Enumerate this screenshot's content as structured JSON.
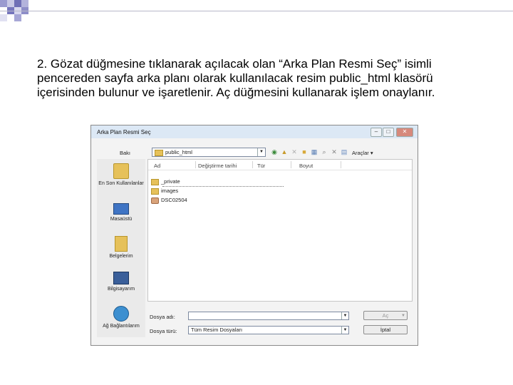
{
  "slide": {
    "step_number": "2.",
    "text": " Gözat düğmesine tıklanarak açılacak olan “Arka Plan Resmi Seç” isimli pencereden sayfa arka planı olarak kullanılacak resim public_html klasörü içerisinden bulunur ve işaretlenir. Aç düğmesini kullanarak işlem onaylanır."
  },
  "dialog": {
    "title": "Arka Plan Resmi Seç",
    "window_buttons": [
      "–",
      "□",
      "✕"
    ],
    "look_in_label": "Bakı",
    "look_in_value": "public_html",
    "tools_label": "Araçlar",
    "places": [
      {
        "label": "En Son Kullanılanlar",
        "icon": "recent-folder-icon"
      },
      {
        "label": "Masaüstü",
        "icon": "desktop-icon"
      },
      {
        "label": "Belgelerim",
        "icon": "documents-icon"
      },
      {
        "label": "Bilgisayarım",
        "icon": "computer-icon"
      },
      {
        "label": "Ağ Bağlantılarım",
        "icon": "network-icon"
      }
    ],
    "columns": [
      "Ad",
      "Değiştirme tarihi",
      "Tür",
      "Boyut"
    ],
    "files": [
      {
        "name": "_private",
        "type": "folder"
      },
      {
        "name": "images",
        "type": "folder"
      },
      {
        "name": "DSC02504",
        "type": "image"
      }
    ],
    "filename_label": "Dosya adı:",
    "filename_value": "",
    "filetype_label": "Dosya türü:",
    "filetype_value": "Tüm Resim Dosyaları",
    "open_button": "Aç",
    "cancel_button": "İptal"
  }
}
